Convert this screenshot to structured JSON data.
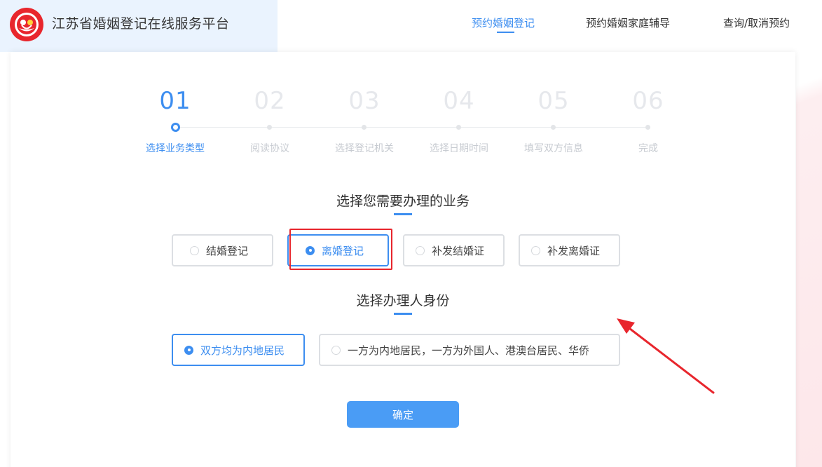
{
  "header": {
    "site_title": "江苏省婚姻登记在线服务平台",
    "nav": [
      {
        "label": "预约婚姻登记",
        "active": true
      },
      {
        "label": "预约婚姻家庭辅导",
        "active": false
      },
      {
        "label": "查询/取消预约",
        "active": false
      }
    ]
  },
  "steps": [
    {
      "num": "01",
      "label": "选择业务类型",
      "active": true
    },
    {
      "num": "02",
      "label": "阅读协议",
      "active": false
    },
    {
      "num": "03",
      "label": "选择登记机关",
      "active": false
    },
    {
      "num": "04",
      "label": "选择日期时间",
      "active": false
    },
    {
      "num": "05",
      "label": "填写双方信息",
      "active": false
    },
    {
      "num": "06",
      "label": "完成",
      "active": false
    }
  ],
  "business": {
    "title": "选择您需要办理的业务",
    "options": [
      {
        "label": "结婚登记",
        "selected": false
      },
      {
        "label": "离婚登记",
        "selected": true
      },
      {
        "label": "补发结婚证",
        "selected": false
      },
      {
        "label": "补发离婚证",
        "selected": false
      }
    ]
  },
  "identity": {
    "title": "选择办理人身份",
    "options": [
      {
        "label": "双方均为内地居民",
        "selected": true
      },
      {
        "label": "一方为内地居民，一方为外国人、港澳台居民、华侨",
        "selected": false
      }
    ]
  },
  "confirm_label": "确定",
  "colors": {
    "accent": "#3d8ef0",
    "annotation_red": "#e8262d"
  }
}
